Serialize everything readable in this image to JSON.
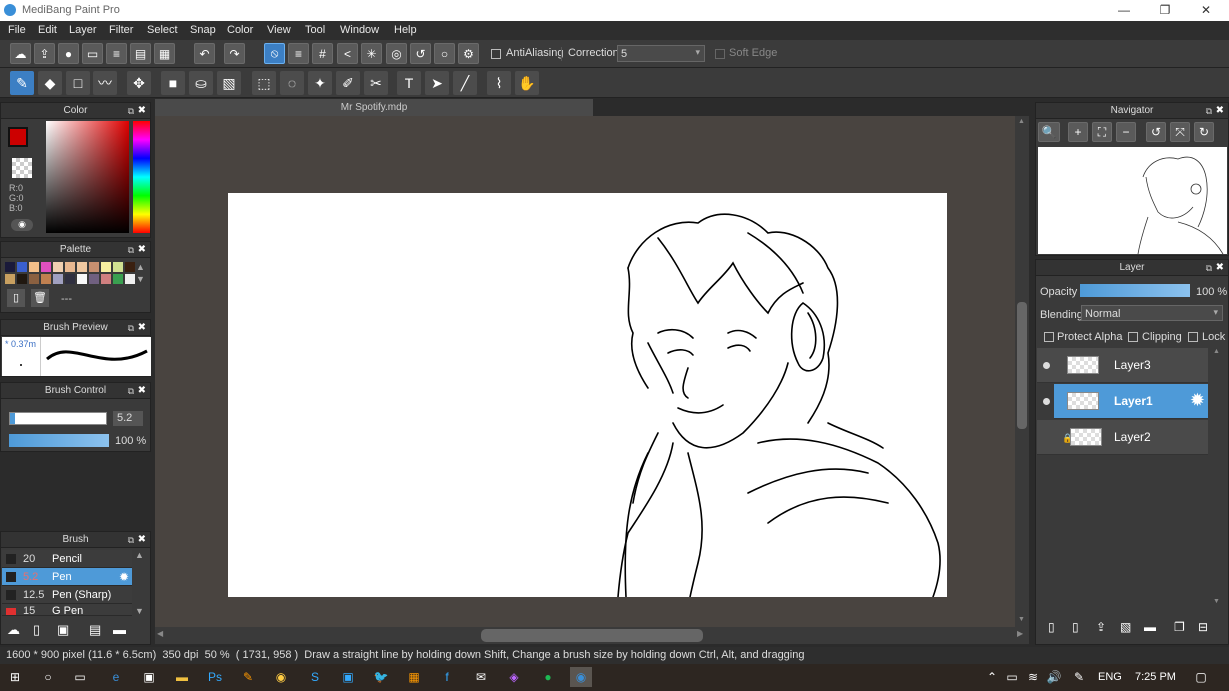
{
  "app": {
    "title": "MediBang Paint Pro"
  },
  "menu": [
    "File",
    "Edit",
    "Layer",
    "Filter",
    "Select",
    "Snap",
    "Color",
    "View",
    "Tool",
    "Window",
    "Help"
  ],
  "toolbar": {
    "antialiasing_label": "AntiAliasing",
    "correction_label": "Correction",
    "correction_value": "5",
    "soft_edge_label": "Soft Edge"
  },
  "document": {
    "tab_title": "Mr Spotify.mdp"
  },
  "color_panel": {
    "title": "Color",
    "r": "R:0",
    "g": "G:0",
    "b": "B:0",
    "foreground": "#cc0000"
  },
  "palette_panel": {
    "title": "Palette",
    "colors": [
      "#1a1a3a",
      "#3a5fcd",
      "#f4c08a",
      "#e050c0",
      "#f0d0b0",
      "#e8b890",
      "#f0c8a0",
      "#c89070",
      "#f8f0a0",
      "#d0e090",
      "#3a2010",
      "#c8a060",
      "#201810",
      "#8a6040",
      "#c08050",
      "#a0a0c0",
      "#303040",
      "#f8f8f8",
      "#706080",
      "#d08080",
      "#3aa050",
      "#f0f0f0"
    ],
    "empty_label": "---"
  },
  "brush_preview": {
    "title": "Brush Preview",
    "size_label": "0.37m"
  },
  "brush_control": {
    "title": "Brush Control",
    "size_value": "5.2",
    "opacity_value": "100 %"
  },
  "brush_panel": {
    "title": "Brush",
    "items": [
      {
        "size": "20",
        "name": "Pencil"
      },
      {
        "size": "5.2",
        "name": "Pen"
      },
      {
        "size": "12.5",
        "name": "Pen (Sharp)"
      },
      {
        "size": "15",
        "name": "G Pen"
      }
    ]
  },
  "navigator": {
    "title": "Navigator"
  },
  "layer_panel": {
    "title": "Layer",
    "opacity_label": "Opacity",
    "opacity_value": "100 %",
    "opacity_fraction": 1.0,
    "blending_label": "Blending",
    "blending_value": "Normal",
    "protect_alpha_label": "Protect Alpha",
    "clipping_label": "Clipping",
    "lock_label": "Lock",
    "layers": [
      {
        "name": "Layer3"
      },
      {
        "name": "Layer1"
      },
      {
        "name": "Layer2"
      }
    ]
  },
  "status": {
    "size": "1600 * 900 pixel",
    "physical": "(11.6 * 6.5cm)",
    "dpi": "350 dpi",
    "zoom": "50 %",
    "coords": "( 1731, 958 )",
    "hint": "Draw a straight line by holding down Shift, Change a brush size by holding down Ctrl, Alt, and dragging"
  },
  "taskbar": {
    "lang": "ENG",
    "time": "7:25 PM"
  }
}
